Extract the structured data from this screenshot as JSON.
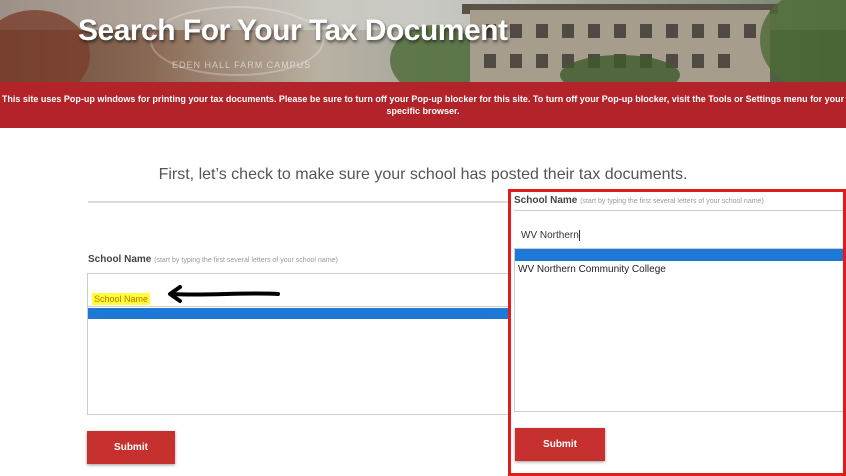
{
  "header": {
    "title": "Search For Your Tax Document",
    "campus_watermark": "EDEN HALL FARM CAMPUS"
  },
  "notice": {
    "text": "This site uses Pop-up windows for printing your tax documents. Please be sure to turn off your Pop-up blocker for this site. To turn off your Pop-up blocker, visit the Tools or Settings menu for your specific browser."
  },
  "main": {
    "intro": "First, let’s check to make sure your school has posted their tax documents.",
    "school_label": "School Name",
    "school_hint": "(start by typing the first several letters of your school name)",
    "school_placeholder": "School Name",
    "submit_label": "Submit"
  },
  "panel": {
    "school_label": "School Name",
    "school_hint": "(start by typing the first several letters of your school name)",
    "input_value": "WV Northern",
    "results": [
      "WV Northern Community College"
    ],
    "submit_label": "Submit"
  },
  "colors": {
    "brand_red": "#b3232a",
    "button_red": "#c6302e",
    "highlight_blue": "#1e79d6",
    "annotation_red": "#e21b1b",
    "highlight_yellow": "#ffff3a"
  }
}
